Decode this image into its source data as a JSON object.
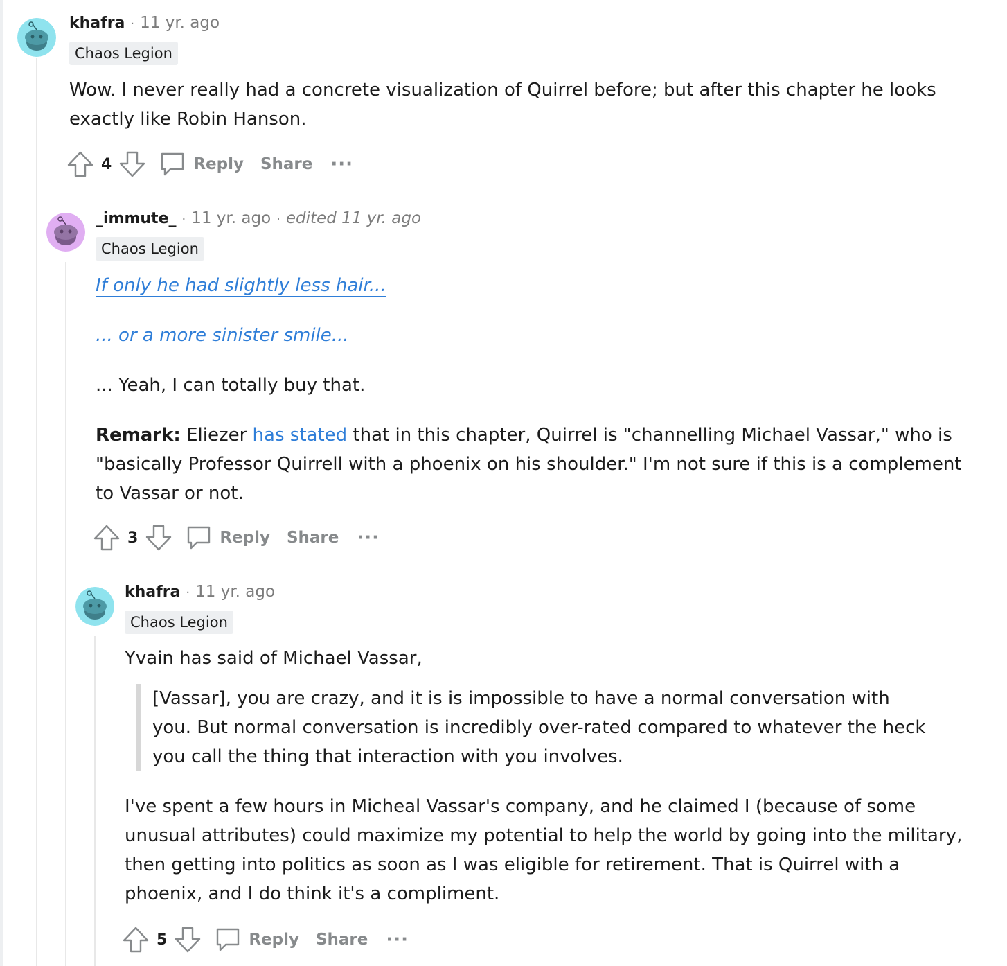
{
  "comments": [
    {
      "author": "khafra",
      "time": "11 yr. ago",
      "flair": "Chaos Legion",
      "avatar_color": "#8fe3ee",
      "body": "Wow. I never really had a concrete visualization of Quirrel before; but after this chapter he looks exactly like Robin Hanson.",
      "score": "4",
      "reply_label": "Reply",
      "share_label": "Share",
      "more_label": "···"
    },
    {
      "author": "_immute_",
      "time": "11 yr. ago",
      "edited": "edited 11 yr. ago",
      "flair": "Chaos Legion",
      "avatar_color": "#e0aef2",
      "link1": "If only he had slightly less hair...",
      "link2": "... or a more sinister smile...",
      "para3": "... Yeah, I can totally buy that.",
      "remark_label": "Remark:",
      "remark_pre": " Eliezer ",
      "remark_link": "has stated",
      "remark_post": " that in this chapter, Quirrel is \"channelling Michael Vassar,\" who is \"basically Professor Quirrell with a phoenix on his shoulder.\" I'm not sure if this is a complement to Vassar or not.",
      "score": "3",
      "reply_label": "Reply",
      "share_label": "Share",
      "more_label": "···"
    },
    {
      "author": "khafra",
      "time": "11 yr. ago",
      "flair": "Chaos Legion",
      "avatar_color": "#8fe3ee",
      "intro": "Yvain has said of Michael Vassar,",
      "quote": "[Vassar], you are crazy, and it is is impossible to have a normal conversation with you. But normal conversation is incredibly over-rated compared to whatever the heck you call the thing that interaction with you involves.",
      "para": "I've spent a few hours in Micheal Vassar's company, and he claimed I (because of some unusual attributes) could maximize my potential to help the world by going into the military, then getting into politics as soon as I was eligible for retirement. That is Quirrel with a phoenix, and I do think it's a compliment.",
      "score": "5",
      "reply_label": "Reply",
      "share_label": "Share",
      "more_label": "···"
    }
  ],
  "icons": {
    "upvote": "upvote-arrow-icon",
    "downvote": "downvote-arrow-icon",
    "comment": "comment-bubble-icon",
    "more": "ellipsis-icon",
    "avatar": "snoo-avatar-icon"
  },
  "colors": {
    "link": "#2f7ed8",
    "meta_gray": "#7c7c7c",
    "flair_bg": "#edeff1",
    "thread_line": "#e8e8e8"
  }
}
